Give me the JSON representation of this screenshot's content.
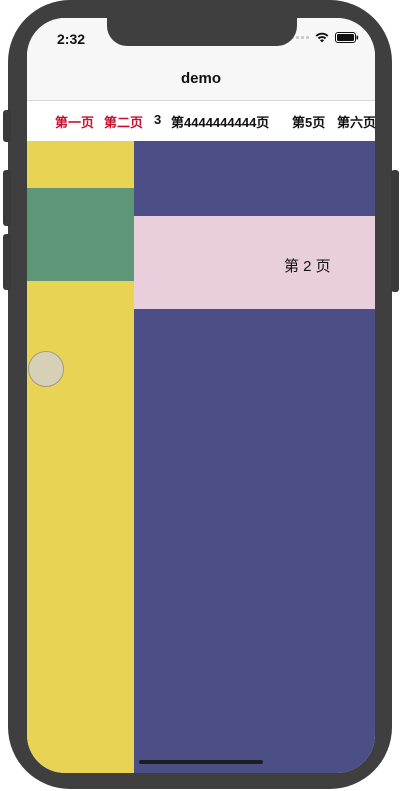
{
  "status_bar": {
    "time": "2:32",
    "icons": [
      "signal-icon",
      "wifi-icon",
      "battery-icon"
    ]
  },
  "nav": {
    "title": "demo"
  },
  "tabs": [
    {
      "label": "第一页",
      "selected": false
    },
    {
      "label": "第二页",
      "selected": true
    },
    {
      "label": "3",
      "selected": false
    },
    {
      "label": "第4444444444页",
      "selected": false
    },
    {
      "label": "第5页",
      "selected": false
    },
    {
      "label": "第六页",
      "selected": false
    }
  ],
  "page": {
    "label": "第 2 页"
  },
  "colors": {
    "active_tab": "#c8102e",
    "left_panel": "#e8d354",
    "left_block": "#5e9678",
    "right_panel": "#4c4f85",
    "card": "#e9cfdb",
    "handle": "#d6d1b6"
  }
}
